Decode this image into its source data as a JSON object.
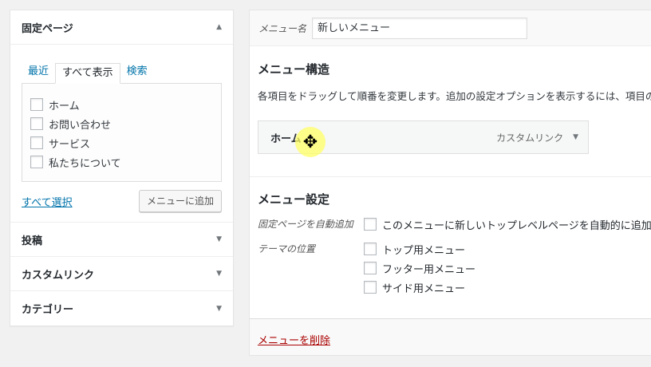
{
  "pages_section": {
    "title": "固定ページ",
    "tabs": [
      "最近",
      "すべて表示",
      "検索"
    ],
    "items": [
      "ホーム",
      "お問い合わせ",
      "サービス",
      "私たちについて"
    ],
    "select_all": "すべて選択",
    "add_button": "メニューに追加"
  },
  "other_sections": [
    "投稿",
    "カスタムリンク",
    "カテゴリー"
  ],
  "menu": {
    "name_label": "メニュー名",
    "name_value": "新しいメニュー",
    "structure_title": "メニュー構造",
    "instructions": "各項目をドラッグして順番を変更します。追加の設定オプションを表示するには、項目の右側",
    "item": {
      "title": "ホーム",
      "type": "カスタムリンク"
    },
    "settings_title": "メニュー設定",
    "auto_add_label": "固定ページを自動追加",
    "auto_add_option": "このメニューに新しいトップレベルページを自動的に追加",
    "location_label": "テーマの位置",
    "locations": [
      "トップ用メニュー",
      "フッター用メニュー",
      "サイド用メニュー"
    ],
    "delete_link": "メニューを削除"
  }
}
